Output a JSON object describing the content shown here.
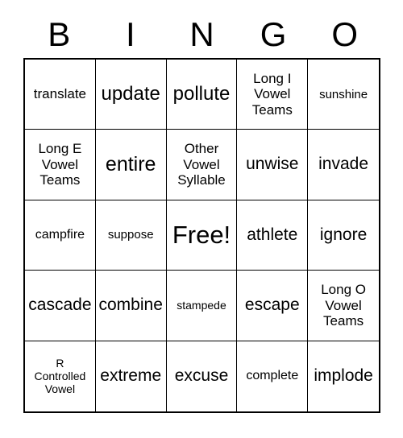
{
  "card": {
    "header_letters": [
      "B",
      "I",
      "N",
      "G",
      "O"
    ],
    "free_space_label": "Free!",
    "colors": {
      "background": "#ffffff",
      "text": "#000000",
      "grid_line": "#000000"
    },
    "rows": [
      [
        {
          "label": "translate",
          "size": "s-lg"
        },
        {
          "label": "update",
          "size": "s-2xl"
        },
        {
          "label": "pollute",
          "size": "s-2xl"
        },
        {
          "label": "Long I\nVowel\nTeams",
          "size": "s-lg"
        },
        {
          "label": "sunshine",
          "size": "s-sm"
        }
      ],
      [
        {
          "label": "Long E\nVowel\nTeams",
          "size": "s-lg"
        },
        {
          "label": "entire",
          "size": "s-3xl"
        },
        {
          "label": "Other\nVowel\nSyllable",
          "size": "s-lg"
        },
        {
          "label": "unwise",
          "size": "s-xl"
        },
        {
          "label": "invade",
          "size": "s-xl"
        }
      ],
      [
        {
          "label": "campfire",
          "size": "s-md"
        },
        {
          "label": "suppose",
          "size": "s-sm"
        },
        {
          "label": "Free!",
          "size": "s-free"
        },
        {
          "label": "athlete",
          "size": "s-xl"
        },
        {
          "label": "ignore",
          "size": "s-xl"
        }
      ],
      [
        {
          "label": "cascade",
          "size": "s-xl"
        },
        {
          "label": "combine",
          "size": "s-xl"
        },
        {
          "label": "stampede",
          "size": "s-xs"
        },
        {
          "label": "escape",
          "size": "s-xl"
        },
        {
          "label": "Long O\nVowel\nTeams",
          "size": "s-lg"
        }
      ],
      [
        {
          "label": "R\nControlled\nVowel",
          "size": "s-xs"
        },
        {
          "label": "extreme",
          "size": "s-xl"
        },
        {
          "label": "excuse",
          "size": "s-xl"
        },
        {
          "label": "complete",
          "size": "s-md"
        },
        {
          "label": "implode",
          "size": "s-xl"
        }
      ]
    ]
  }
}
